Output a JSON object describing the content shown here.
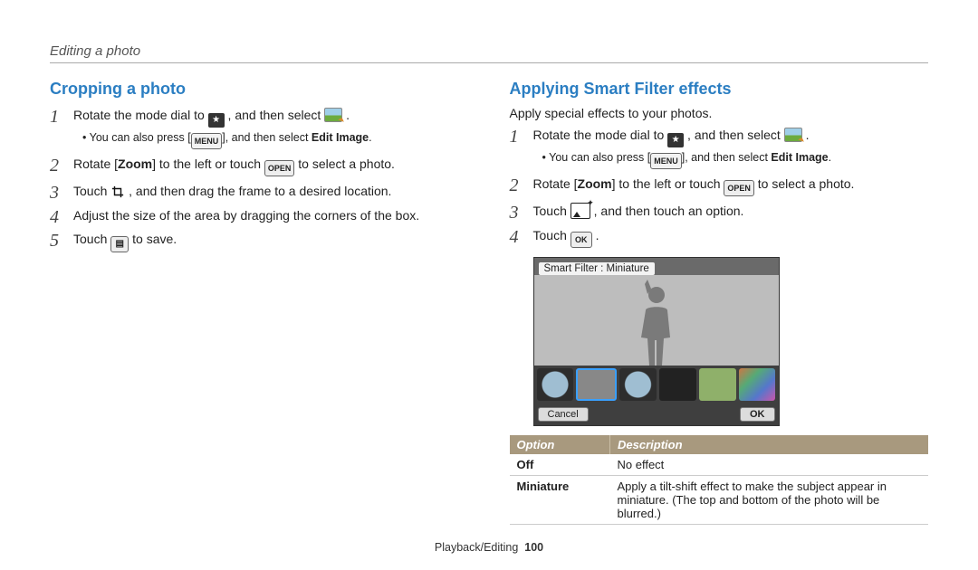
{
  "header": {
    "breadcrumb": "Editing a photo"
  },
  "footer": {
    "section": "Playback/Editing",
    "page": "100"
  },
  "ui": {
    "menu_button": "MENU",
    "open_button": "OPEN",
    "ok_button": "OK",
    "cancel_button": "Cancel",
    "ok_caps": "OK"
  },
  "left": {
    "title": "Cropping a photo",
    "step1_a": "Rotate the mode dial to ",
    "step1_b": ", and then select ",
    "step1_c": ".",
    "sub1_a": "You can also press [",
    "sub1_b": "], and then select ",
    "sub1_c": "Edit Image",
    "sub1_d": ".",
    "step2_a": "Rotate [",
    "step2_b": "Zoom",
    "step2_c": "] to the left or touch ",
    "step2_d": " to select a photo.",
    "step3_a": "Touch ",
    "step3_b": ", and then drag the frame to a desired location.",
    "step4": "Adjust the size of the area by dragging the corners of the box.",
    "step5_a": "Touch ",
    "step5_b": " to save."
  },
  "right": {
    "title": "Applying Smart Filter effects",
    "intro": "Apply special effects to your photos.",
    "step1_a": "Rotate the mode dial to ",
    "step1_b": ", and then select ",
    "step1_c": ".",
    "sub1_a": "You can also press [",
    "sub1_b": "], and then select ",
    "sub1_c": "Edit Image",
    "sub1_d": ".",
    "step2_a": "Rotate [",
    "step2_b": "Zoom",
    "step2_c": "] to the left or touch ",
    "step2_d": " to select a photo.",
    "step3_a": "Touch ",
    "step3_b": ", and then touch an option.",
    "step4_a": "Touch ",
    "step4_b": "."
  },
  "screen": {
    "title": "Smart Filter : Miniature",
    "cancel": "Cancel",
    "ok": "OK"
  },
  "table": {
    "h1": "Option",
    "h2": "Description",
    "rows": [
      {
        "opt": "Off",
        "desc": "No effect"
      },
      {
        "opt": "Miniature",
        "desc": "Apply a tilt-shift effect to make the subject appear in miniature. (The top and bottom of the photo will be blurred.)"
      }
    ]
  }
}
